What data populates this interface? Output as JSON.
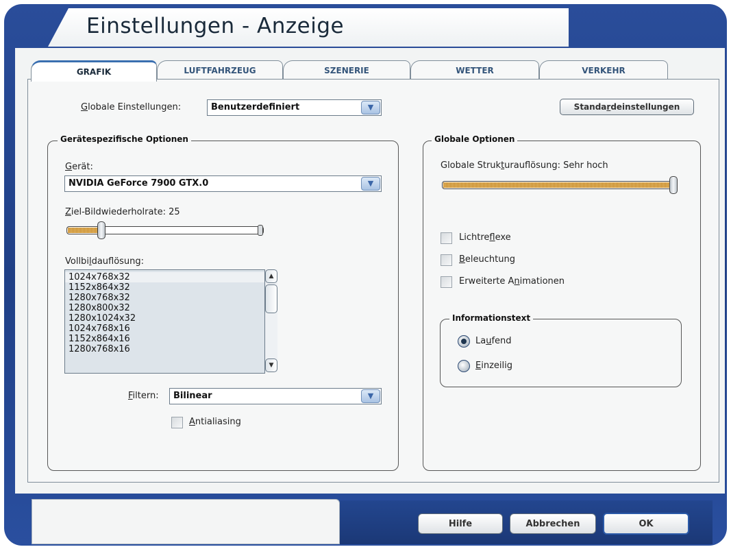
{
  "window": {
    "title": "Einstellungen - Anzeige"
  },
  "tabs": [
    {
      "label": "GRAFIK",
      "active": true
    },
    {
      "label": "LUFTFAHRZEUG",
      "active": false
    },
    {
      "label": "SZENERIE",
      "active": false
    },
    {
      "label": "WETTER",
      "active": false
    },
    {
      "label": "VERKEHR",
      "active": false
    }
  ],
  "global_settings": {
    "label_pre": "",
    "label_u": "G",
    "label_post": "lobale Einstellungen:",
    "value": "Benutzerdefiniert"
  },
  "defaults_button": {
    "pre": "Standa",
    "u": "r",
    "post": "deinstellungen"
  },
  "device_options": {
    "title": "Gerätespezifische Optionen",
    "device_label_u": "G",
    "device_label_post": "erät:",
    "device_value": "NVIDIA GeForce 7900 GTX.0",
    "refresh_label_u": "Z",
    "refresh_label_post": "iel-Bildwiederholrate: 25",
    "refresh_level_percent": 18,
    "resolution_label_pre": "Vollbi",
    "resolution_label_u": "l",
    "resolution_label_post": "dauflösung:",
    "resolutions": [
      "1024x768x32",
      "1152x864x32",
      "1280x768x32",
      "1280x800x32",
      "1280x1024x32",
      "1024x768x16",
      "1152x864x16",
      "1280x768x16"
    ],
    "filter_label_u": "F",
    "filter_label_post": "iltern:",
    "filter_value": "Bilinear",
    "antialiasing_u": "A",
    "antialiasing_post": "ntialiasing",
    "antialiasing_checked": false
  },
  "global_options": {
    "title": "Globale Optionen",
    "texture_label_pre": "Globale Struk",
    "texture_label_u": "t",
    "texture_label_post": "urauflösung: Sehr hoch",
    "texture_level_percent": 100,
    "checkboxes": [
      {
        "pre": "Lichtre",
        "u": "f",
        "post": "lexe",
        "checked": false
      },
      {
        "pre": "",
        "u": "B",
        "post": "eleuchtung",
        "checked": false
      },
      {
        "pre": "Erweiterte A",
        "u": "n",
        "post": "imationen",
        "checked": false
      }
    ],
    "info_text": {
      "title": "Informationstext",
      "options": [
        {
          "pre": "La",
          "u": "u",
          "post": "fend",
          "selected": true
        },
        {
          "pre": "",
          "u": "E",
          "post": "inzeilig",
          "selected": false
        }
      ]
    }
  },
  "footer": {
    "help": "Hilfe",
    "cancel": "Abbrechen",
    "ok": "OK"
  }
}
